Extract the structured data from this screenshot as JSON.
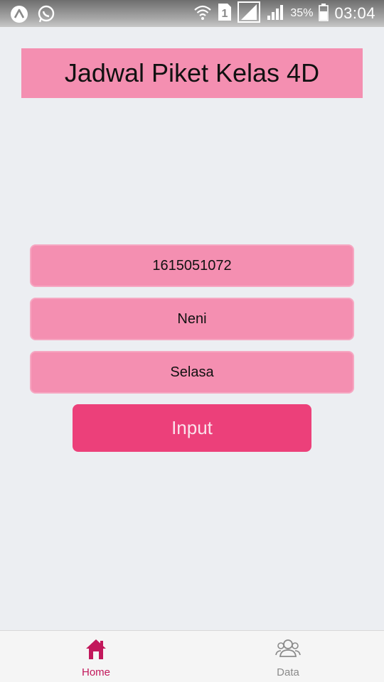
{
  "status_bar": {
    "battery_percent": "35%",
    "time": "03:04",
    "sim_number": "1"
  },
  "header": {
    "title": "Jadwal Piket Kelas 4D"
  },
  "form": {
    "nim_value": "1615051072",
    "name_value": "Neni",
    "day_value": "Selasa",
    "submit_label": "Input"
  },
  "bottom_nav": {
    "items": [
      {
        "label": "Home",
        "icon": "home-icon",
        "active": true
      },
      {
        "label": "Data",
        "icon": "people-icon",
        "active": false
      }
    ]
  },
  "colors": {
    "accent": "#ec407a",
    "field_bg": "#f48fb1",
    "active_nav": "#c2185b"
  }
}
